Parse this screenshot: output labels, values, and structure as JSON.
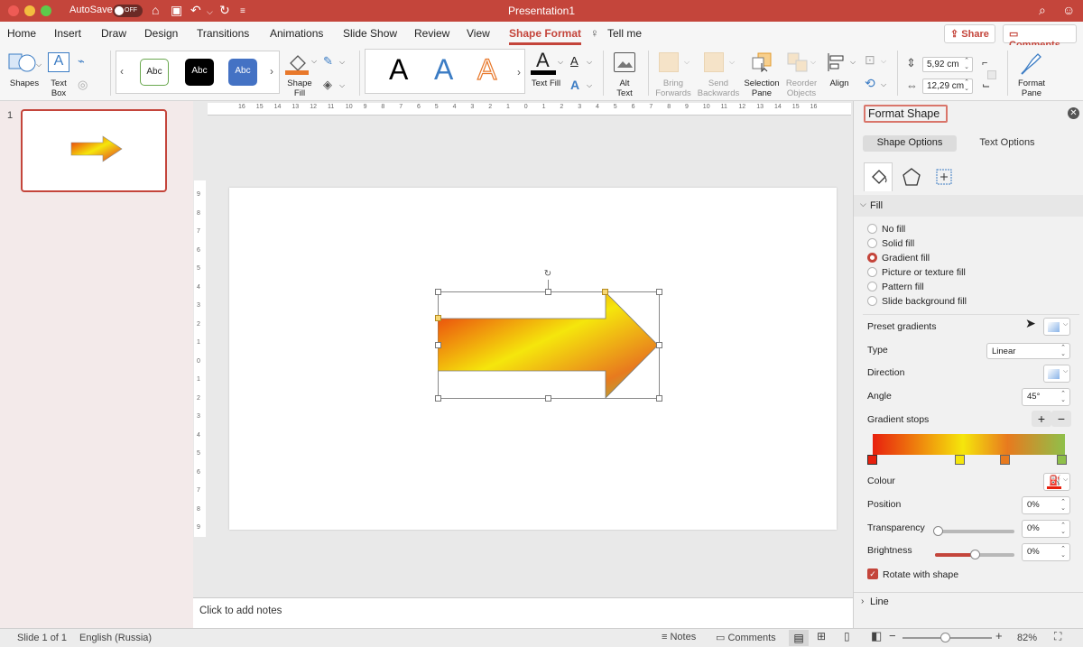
{
  "titlebar": {
    "autosave_label": "AutoSave",
    "autosave_state": "OFF",
    "doc_title": "Presentation1"
  },
  "tabs": [
    {
      "label": "Home"
    },
    {
      "label": "Insert"
    },
    {
      "label": "Draw"
    },
    {
      "label": "Design"
    },
    {
      "label": "Transitions"
    },
    {
      "label": "Animations"
    },
    {
      "label": "Slide Show"
    },
    {
      "label": "Review"
    },
    {
      "label": "View"
    },
    {
      "label": "Shape Format"
    }
  ],
  "tell_me": "Tell me",
  "share_label": "Share",
  "comments_label": "Comments",
  "ribbon": {
    "shapes": "Shapes",
    "text_box_1": "Text",
    "text_box_2": "Box",
    "style_sample": "Abc",
    "shape_fill_1": "Shape",
    "shape_fill_2": "Fill",
    "wordart_sample": "A",
    "text_fill": "Text Fill",
    "alt_text_1": "Alt",
    "alt_text_2": "Text",
    "bring_1": "Bring",
    "bring_2": "Forwards",
    "send_1": "Send",
    "send_2": "Backwards",
    "selection_1": "Selection",
    "selection_2": "Pane",
    "reorder_1": "Reorder",
    "reorder_2": "Objects",
    "align": "Align",
    "height_value": "5,92 cm",
    "width_value": "12,29 cm",
    "format_pane_1": "Format",
    "format_pane_2": "Pane"
  },
  "thumbnail": {
    "number": "1"
  },
  "ruler": {
    "h_ticks": [
      "16",
      "15",
      "14",
      "13",
      "12",
      "11",
      "10",
      "9",
      "8",
      "7",
      "6",
      "5",
      "4",
      "3",
      "2",
      "1",
      "0",
      "1",
      "2",
      "3",
      "4",
      "5",
      "6",
      "7",
      "8",
      "9",
      "10",
      "11",
      "12",
      "13",
      "14",
      "15",
      "16"
    ],
    "v_ticks": [
      "9",
      "8",
      "7",
      "6",
      "5",
      "4",
      "3",
      "2",
      "1",
      "0",
      "1",
      "2",
      "3",
      "4",
      "5",
      "6",
      "7",
      "8",
      "9"
    ]
  },
  "notes_placeholder": "Click to add notes",
  "format_pane": {
    "title": "Format Shape",
    "tab_shape": "Shape Options",
    "tab_text": "Text Options",
    "fill_header": "Fill",
    "fill_options": [
      {
        "label": "No fill",
        "selected": false
      },
      {
        "label": "Solid fill",
        "selected": false
      },
      {
        "label": "Gradient fill",
        "selected": true
      },
      {
        "label": "Picture or texture fill",
        "selected": false
      },
      {
        "label": "Pattern fill",
        "selected": false
      },
      {
        "label": "Slide background fill",
        "selected": false
      }
    ],
    "preset_gradients": "Preset gradients",
    "type_label": "Type",
    "type_value": "Linear",
    "direction_label": "Direction",
    "angle_label": "Angle",
    "angle_value": "45°",
    "gradient_stops_label": "Gradient stops",
    "gradient_stop_colors": [
      "#e8200e",
      "#f5e60c",
      "#e87a1e",
      "#8fc04a"
    ],
    "colour_label": "Colour",
    "position_label": "Position",
    "position_value": "0%",
    "transparency_label": "Transparency",
    "transparency_value": "0%",
    "brightness_label": "Brightness",
    "brightness_value": "0%",
    "rotate_with_shape": "Rotate with shape",
    "rotate_checked": true,
    "line_header": "Line"
  },
  "statusbar": {
    "slide_info": "Slide 1 of 1",
    "language": "English (Russia)",
    "notes": "Notes",
    "comments": "Comments",
    "zoom": "82%"
  },
  "colors": {
    "accent": "#c4453b"
  }
}
